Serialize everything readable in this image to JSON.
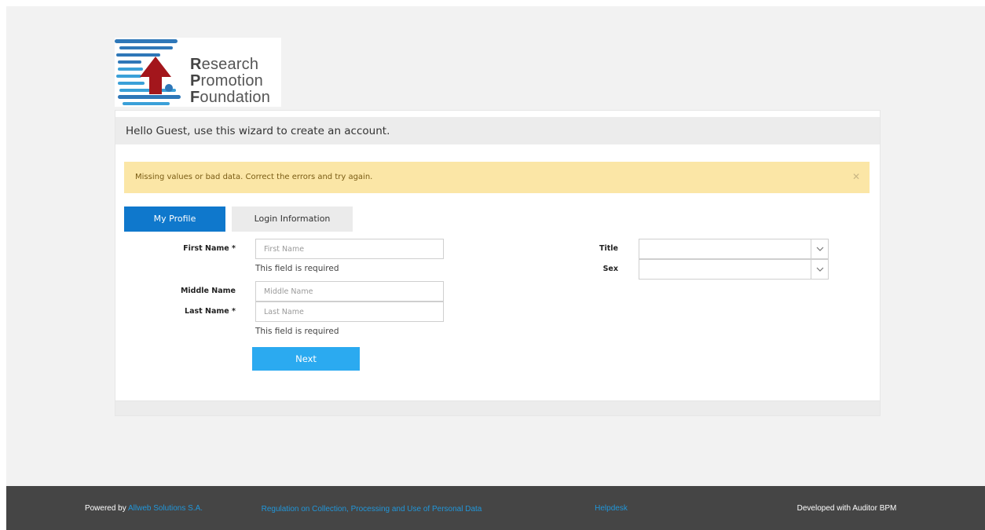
{
  "logo": {
    "line1_initial": "R",
    "line1_rest": "esearch",
    "line2_initial": "P",
    "line2_rest": "romotion",
    "line3_initial": "F",
    "line3_rest": "oundation",
    "icon": "arrow-up-stripes-logo",
    "colors": {
      "blue": "#2e77b8",
      "light_blue": "#3aa0d8",
      "red": "#a3161c"
    }
  },
  "header": {
    "greeting": "Hello Guest, use this wizard to create an account."
  },
  "alert": {
    "message": "Missing values or bad data. Correct the errors and try again.",
    "close_icon": "close-icon"
  },
  "tabs": [
    {
      "label": "My Profile",
      "active": true
    },
    {
      "label": "Login Information",
      "active": false
    }
  ],
  "form": {
    "first_name": {
      "label": "First Name *",
      "placeholder": "First Name",
      "value": "",
      "error": "This field is required"
    },
    "middle_name": {
      "label": "Middle Name",
      "placeholder": "Middle Name",
      "value": ""
    },
    "last_name": {
      "label": "Last Name *",
      "placeholder": "Last Name",
      "value": "",
      "error": "This field is required"
    },
    "title": {
      "label": "Title",
      "value": ""
    },
    "sex": {
      "label": "Sex",
      "value": ""
    },
    "next_label": "Next"
  },
  "footer": {
    "powered_prefix": "Powered by ",
    "powered_link": "Allweb Solutions S.A.",
    "regulation_link": "Regulation on Collection, Processing and Use of Personal Data",
    "helpdesk_link": "Helpdesk",
    "developed": "Developed with Auditor BPM"
  },
  "colors": {
    "primary": "#0f78cc",
    "button": "#2baaf0",
    "alert_bg": "#fbe6a6",
    "footer_bg": "#454545",
    "link": "#2196d9"
  }
}
